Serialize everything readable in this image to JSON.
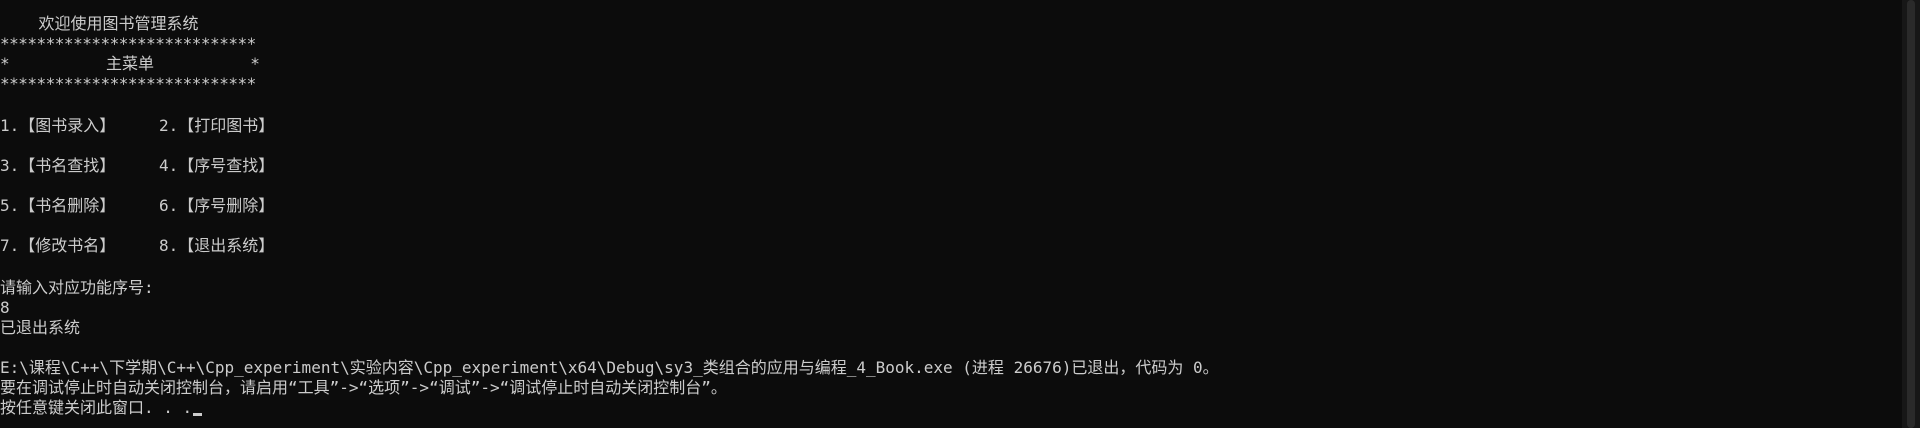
{
  "console": {
    "welcome": "    欢迎使用图书管理系统",
    "stars_top": "****************************",
    "menu_title_line": "*          主菜单          *",
    "stars_bottom": "****************************",
    "menu": [
      {
        "left": "1.【图书录入】",
        "right": "2.【打印图书】"
      },
      {
        "left": "3.【书名查找】",
        "right": "4.【序号查找】"
      },
      {
        "left": "5.【书名删除】",
        "right": "6.【序号删除】"
      },
      {
        "left": "7.【修改书名】",
        "right": "8.【退出系统】"
      }
    ],
    "prompt": "请输入对应功能序号:",
    "user_input": "8",
    "exit_message": "已退出系统",
    "process_exit": "E:\\课程\\C++\\下学期\\C++\\Cpp_experiment\\实验内容\\Cpp_experiment\\x64\\Debug\\sy3_类组合的应用与编程_4_Book.exe (进程 26676)已退出，代码为 0。",
    "auto_close_hint": "要在调试停止时自动关闭控制台，请启用“工具”->“选项”->“调试”->“调试停止时自动关闭控制台”。",
    "press_any_key": "按任意键关闭此窗口. . ."
  },
  "colors": {
    "background": "#0c0c0c",
    "text": "#cccccc"
  }
}
